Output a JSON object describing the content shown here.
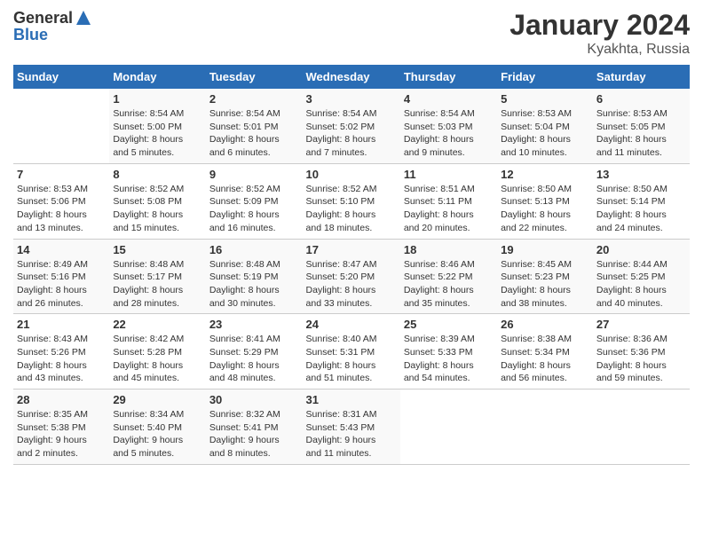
{
  "header": {
    "logo_general": "General",
    "logo_blue": "Blue",
    "month_title": "January 2024",
    "location": "Kyakhta, Russia"
  },
  "days_of_week": [
    "Sunday",
    "Monday",
    "Tuesday",
    "Wednesday",
    "Thursday",
    "Friday",
    "Saturday"
  ],
  "weeks": [
    [
      {
        "day": "",
        "info": ""
      },
      {
        "day": "1",
        "info": "Sunrise: 8:54 AM\nSunset: 5:00 PM\nDaylight: 8 hours\nand 5 minutes."
      },
      {
        "day": "2",
        "info": "Sunrise: 8:54 AM\nSunset: 5:01 PM\nDaylight: 8 hours\nand 6 minutes."
      },
      {
        "day": "3",
        "info": "Sunrise: 8:54 AM\nSunset: 5:02 PM\nDaylight: 8 hours\nand 7 minutes."
      },
      {
        "day": "4",
        "info": "Sunrise: 8:54 AM\nSunset: 5:03 PM\nDaylight: 8 hours\nand 9 minutes."
      },
      {
        "day": "5",
        "info": "Sunrise: 8:53 AM\nSunset: 5:04 PM\nDaylight: 8 hours\nand 10 minutes."
      },
      {
        "day": "6",
        "info": "Sunrise: 8:53 AM\nSunset: 5:05 PM\nDaylight: 8 hours\nand 11 minutes."
      }
    ],
    [
      {
        "day": "7",
        "info": "Sunrise: 8:53 AM\nSunset: 5:06 PM\nDaylight: 8 hours\nand 13 minutes."
      },
      {
        "day": "8",
        "info": "Sunrise: 8:52 AM\nSunset: 5:08 PM\nDaylight: 8 hours\nand 15 minutes."
      },
      {
        "day": "9",
        "info": "Sunrise: 8:52 AM\nSunset: 5:09 PM\nDaylight: 8 hours\nand 16 minutes."
      },
      {
        "day": "10",
        "info": "Sunrise: 8:52 AM\nSunset: 5:10 PM\nDaylight: 8 hours\nand 18 minutes."
      },
      {
        "day": "11",
        "info": "Sunrise: 8:51 AM\nSunset: 5:11 PM\nDaylight: 8 hours\nand 20 minutes."
      },
      {
        "day": "12",
        "info": "Sunrise: 8:50 AM\nSunset: 5:13 PM\nDaylight: 8 hours\nand 22 minutes."
      },
      {
        "day": "13",
        "info": "Sunrise: 8:50 AM\nSunset: 5:14 PM\nDaylight: 8 hours\nand 24 minutes."
      }
    ],
    [
      {
        "day": "14",
        "info": "Sunrise: 8:49 AM\nSunset: 5:16 PM\nDaylight: 8 hours\nand 26 minutes."
      },
      {
        "day": "15",
        "info": "Sunrise: 8:48 AM\nSunset: 5:17 PM\nDaylight: 8 hours\nand 28 minutes."
      },
      {
        "day": "16",
        "info": "Sunrise: 8:48 AM\nSunset: 5:19 PM\nDaylight: 8 hours\nand 30 minutes."
      },
      {
        "day": "17",
        "info": "Sunrise: 8:47 AM\nSunset: 5:20 PM\nDaylight: 8 hours\nand 33 minutes."
      },
      {
        "day": "18",
        "info": "Sunrise: 8:46 AM\nSunset: 5:22 PM\nDaylight: 8 hours\nand 35 minutes."
      },
      {
        "day": "19",
        "info": "Sunrise: 8:45 AM\nSunset: 5:23 PM\nDaylight: 8 hours\nand 38 minutes."
      },
      {
        "day": "20",
        "info": "Sunrise: 8:44 AM\nSunset: 5:25 PM\nDaylight: 8 hours\nand 40 minutes."
      }
    ],
    [
      {
        "day": "21",
        "info": "Sunrise: 8:43 AM\nSunset: 5:26 PM\nDaylight: 8 hours\nand 43 minutes."
      },
      {
        "day": "22",
        "info": "Sunrise: 8:42 AM\nSunset: 5:28 PM\nDaylight: 8 hours\nand 45 minutes."
      },
      {
        "day": "23",
        "info": "Sunrise: 8:41 AM\nSunset: 5:29 PM\nDaylight: 8 hours\nand 48 minutes."
      },
      {
        "day": "24",
        "info": "Sunrise: 8:40 AM\nSunset: 5:31 PM\nDaylight: 8 hours\nand 51 minutes."
      },
      {
        "day": "25",
        "info": "Sunrise: 8:39 AM\nSunset: 5:33 PM\nDaylight: 8 hours\nand 54 minutes."
      },
      {
        "day": "26",
        "info": "Sunrise: 8:38 AM\nSunset: 5:34 PM\nDaylight: 8 hours\nand 56 minutes."
      },
      {
        "day": "27",
        "info": "Sunrise: 8:36 AM\nSunset: 5:36 PM\nDaylight: 8 hours\nand 59 minutes."
      }
    ],
    [
      {
        "day": "28",
        "info": "Sunrise: 8:35 AM\nSunset: 5:38 PM\nDaylight: 9 hours\nand 2 minutes."
      },
      {
        "day": "29",
        "info": "Sunrise: 8:34 AM\nSunset: 5:40 PM\nDaylight: 9 hours\nand 5 minutes."
      },
      {
        "day": "30",
        "info": "Sunrise: 8:32 AM\nSunset: 5:41 PM\nDaylight: 9 hours\nand 8 minutes."
      },
      {
        "day": "31",
        "info": "Sunrise: 8:31 AM\nSunset: 5:43 PM\nDaylight: 9 hours\nand 11 minutes."
      },
      {
        "day": "",
        "info": ""
      },
      {
        "day": "",
        "info": ""
      },
      {
        "day": "",
        "info": ""
      }
    ]
  ]
}
